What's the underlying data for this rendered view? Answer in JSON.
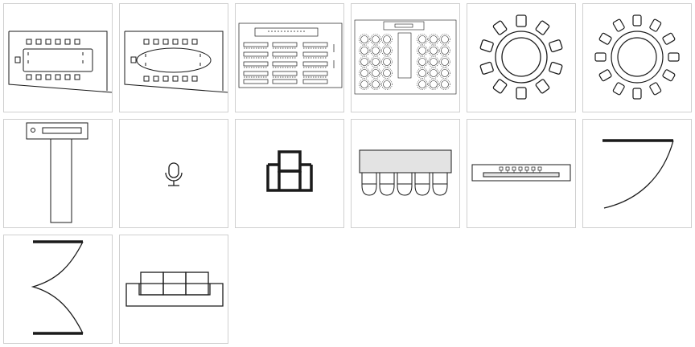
{
  "colors": {
    "stroke": "#1a1a1a",
    "light_fill": "#e3e3e3",
    "tile_border": "#cfcfcf"
  },
  "palette": {
    "items": [
      {
        "id": "boardroom-rect",
        "icon": "boardroom-rectangular-table-icon"
      },
      {
        "id": "boardroom-oval",
        "icon": "boardroom-oval-table-icon"
      },
      {
        "id": "classroom",
        "icon": "classroom-layout-icon"
      },
      {
        "id": "banquet",
        "icon": "banquet-round-tables-layout-icon"
      },
      {
        "id": "round-10",
        "icon": "round-table-10-chairs-icon"
      },
      {
        "id": "round-12",
        "icon": "round-table-12-chairs-icon"
      },
      {
        "id": "head-table-t",
        "icon": "t-shape-head-table-icon"
      },
      {
        "id": "microphone",
        "icon": "microphone-icon"
      },
      {
        "id": "armchair",
        "icon": "armchair-icon"
      },
      {
        "id": "table-5-chairs",
        "icon": "table-with-five-chairs-icon"
      },
      {
        "id": "long-table-chairs",
        "icon": "long-table-with-chairs-icon"
      },
      {
        "id": "curved-wall-right",
        "icon": "curved-wall-segment-icon"
      },
      {
        "id": "double-curved-wall",
        "icon": "double-curved-wall-icon"
      },
      {
        "id": "sofa",
        "icon": "sofa-icon"
      }
    ]
  }
}
